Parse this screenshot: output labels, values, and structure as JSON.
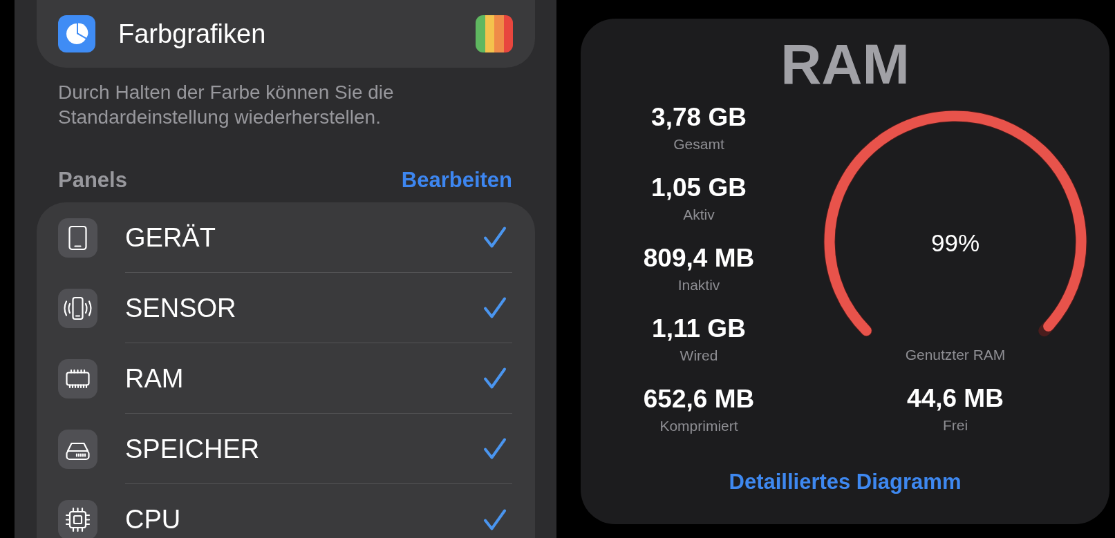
{
  "color_graphics": {
    "label": "Farbgrafiken",
    "footer": "Durch Halten der Farbe können Sie die Standardeinstellung wiederherstellen."
  },
  "panels": {
    "header": "Panels",
    "edit_button": "Bearbeiten",
    "items": [
      {
        "kind": "device",
        "label": "GERÄT",
        "checked": true
      },
      {
        "kind": "sensor",
        "label": "SENSOR",
        "checked": true
      },
      {
        "kind": "ram",
        "label": "RAM",
        "checked": true
      },
      {
        "kind": "storage",
        "label": "SPEICHER",
        "checked": true
      },
      {
        "kind": "cpu",
        "label": "CPU",
        "checked": true
      }
    ]
  },
  "ram_card": {
    "title": "RAM",
    "stats": [
      {
        "value": "3,78 GB",
        "label": "Gesamt"
      },
      {
        "value": "1,05 GB",
        "label": "Aktiv"
      },
      {
        "value": "809,4 MB",
        "label": "Inaktiv"
      },
      {
        "value": "1,11 GB",
        "label": "Wired"
      },
      {
        "value": "652,6 MB",
        "label": "Komprimiert"
      }
    ],
    "gauge": {
      "level": 0.99,
      "reading": "99%",
      "label": "Genutzter RAM"
    },
    "free": {
      "value": "44,6 MB",
      "label": "Frei"
    },
    "link": "Detailliertes Diagramm"
  }
}
